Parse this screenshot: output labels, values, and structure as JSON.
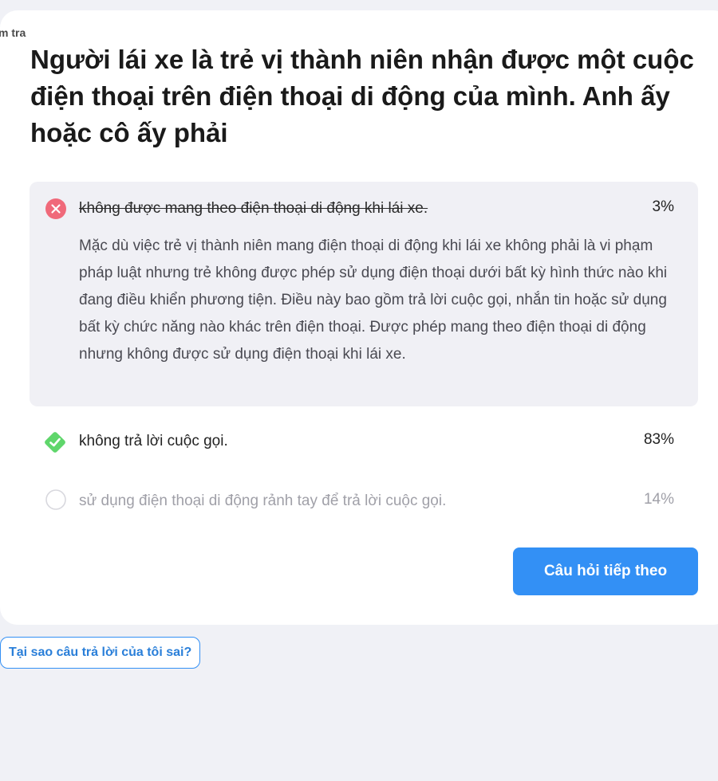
{
  "breadcrumb": "m tra",
  "question": "Người lái xe là trẻ vị thành niên nhận được một cuộc điện thoại trên điện thoại di động của mình. Anh ấy hoặc cô ấy phải",
  "options": [
    {
      "label": "không được mang theo điện thoại di động khi lái xe.",
      "percent": "3%",
      "state": "wrong",
      "explanation": "Mặc dù việc trẻ vị thành niên mang điện thoại di động khi lái xe không phải là vi phạm pháp luật nhưng trẻ không được phép sử dụng điện thoại dưới bất kỳ hình thức nào khi đang điều khiển phương tiện. Điều này bao gồm trả lời cuộc gọi, nhắn tin hoặc sử dụng bất kỳ chức năng nào khác trên điện thoại. Được phép mang theo điện thoại di động nhưng không được sử dụng điện thoại khi lái xe."
    },
    {
      "label": "không trả lời cuộc gọi.",
      "percent": "83%",
      "state": "correct"
    },
    {
      "label": "sử dụng điện thoại di động rảnh tay để trả lời cuộc gọi.",
      "percent": "14%",
      "state": "unselected"
    }
  ],
  "next_button": "Câu hỏi tiếp theo",
  "why_button": "Tại sao câu trả lời của tôi sai?",
  "icons": {
    "wrong": "x-circle-icon",
    "correct": "check-diamond-icon",
    "unselected": "empty-circle-icon"
  },
  "colors": {
    "wrong": "#f0697a",
    "correct": "#5fd66b",
    "accent": "#3390f5"
  }
}
